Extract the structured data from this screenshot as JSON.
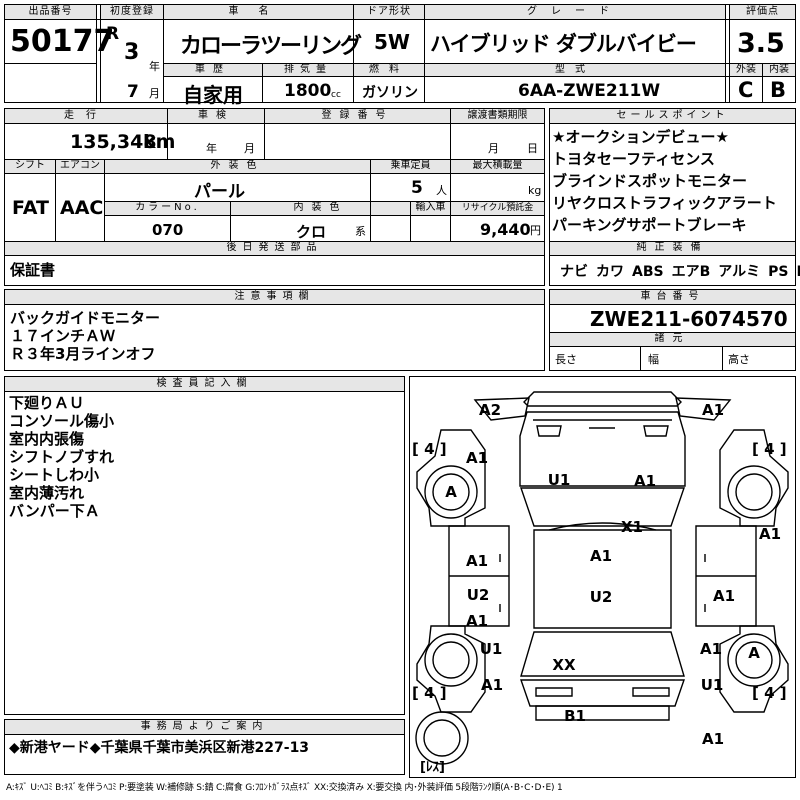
{
  "header": {
    "lot_label": "出品番号",
    "lot_number": "50177",
    "first_reg_label": "初度登録",
    "era": "R",
    "year": "3",
    "year_unit": "年",
    "month": "7",
    "month_unit": "月",
    "car_name_label": "車名",
    "car_name": "カローラツーリング",
    "door_label": "ドア形状",
    "door": "5W",
    "grade_label": "グレード",
    "grade": "ハイブリッド ダブルバイビー",
    "score_label": "評価点",
    "score": "3.5",
    "history_label": "車歴",
    "history": "自家用",
    "displacement_label": "排気量",
    "displacement": "1800",
    "displacement_unit": "cc",
    "fuel_label": "燃料",
    "fuel": "ガソリン",
    "model_label": "型式",
    "model": "6AA-ZWE211W",
    "exterior_label": "外装",
    "exterior_grade": "C",
    "interior_label": "内装",
    "interior_grade": "B"
  },
  "row2": {
    "mileage_label": "走行",
    "mileage": "135,348",
    "mileage_unit": "km",
    "inspection_label": "車検",
    "insp_year_unit": "年",
    "insp_month_unit": "月",
    "reg_no_label": "登録番号",
    "transfer_label": "譲渡書類期限",
    "transfer_month_unit": "月",
    "transfer_day_unit": "日",
    "shift_label": "シフト",
    "shift": "FAT",
    "ac_label": "エアコン",
    "ac": "AAC",
    "color_label": "外装色",
    "color": "パール",
    "capacity_label": "乗車定員",
    "capacity": "5",
    "capacity_unit": "人",
    "max_load_label": "最大積載量",
    "max_load_unit": "kg",
    "color_no_label": "カラーNo.",
    "color_no": "070",
    "int_color_label": "内装色",
    "int_color": "クロ",
    "int_color_unit": "系",
    "import_label": "輸入車",
    "recycle_label": "リサイクル預託金",
    "recycle": "9,440",
    "recycle_unit": "円",
    "later_parts_label": "後日発送部品",
    "later_parts": "保証書"
  },
  "sales_points": {
    "label": "セールスポイント",
    "items": [
      "★オークションデビュー★",
      "トヨタセーフティセンス",
      "ブラインドスポットモニター",
      "リヤクロストラフィックアラート",
      "パーキングサポートブレーキ"
    ]
  },
  "equipment": {
    "label": "純正装備",
    "items": [
      "ナビ",
      "カワ",
      "ABS",
      "エアB",
      "アルミ",
      "PS",
      "PW"
    ]
  },
  "notes": {
    "label": "注意事項欄",
    "lines": [
      "バックガイドモニター",
      "１７インチＡＷ",
      "Ｒ３年3月ラインオフ"
    ]
  },
  "chassis": {
    "label": "車台番号",
    "number": "ZWE211-6074570",
    "spec_label": "諸元",
    "length_label": "長さ",
    "width_label": "幅",
    "height_label": "高さ"
  },
  "inspector": {
    "label": "検査員記入欄",
    "lines": [
      "下廻りＡＵ",
      "コンソール傷小",
      "室内内張傷",
      "シフトノブすれ",
      "シートしわ小",
      "室内薄汚れ",
      "バンパー下Ａ"
    ]
  },
  "diagram": {
    "marks": {
      "a2_front": "A2",
      "a1_front_r": "A1",
      "a1_fender_l": "A1",
      "u1_hood": "U1",
      "a1_hood": "A1",
      "x1_windshield": "X1",
      "a1_door_r_front": "A1",
      "a1_door_l_front": "A1",
      "a1_roof": "A1",
      "u2_door_l": "U2",
      "u2_roof": "U2",
      "a1_door_r_rear": "A1",
      "a1_door_l_rear": "A1",
      "u1_quarter_l": "U1",
      "a1_quarter_r": "A1",
      "xx_rear_glass": "XX",
      "a1_rear_l": "A1",
      "u1_rear_r": "U1",
      "b1_rear": "B1",
      "a1_rear_bottom": "A1",
      "wheel_fl": "A",
      "wheel_rr": "A"
    },
    "tire_fl": "[ 4 ]",
    "tire_fr": "[ 4 ]",
    "tire_rl": "[ 4 ]",
    "tire_rr": "[ 4 ]",
    "spare": "[ﾚｽ]"
  },
  "office": {
    "label": "事務局よりご案内",
    "text": "◆新港ヤード◆千葉県千葉市美浜区新港227-13"
  },
  "legend": "A:ｷｽﾞ U:ﾍｺﾐ B:ｷｽﾞを伴うﾍｺﾐ P:要塗装 W:補修跡 S:錆 C:腐食 G:ﾌﾛﾝﾄｶﾞﾗｽ点ｷｽﾞ XX:交換済み X:要交換 内･外装評価 5段階ﾗﾝｸ順(A･B･C･D･E) 1"
}
